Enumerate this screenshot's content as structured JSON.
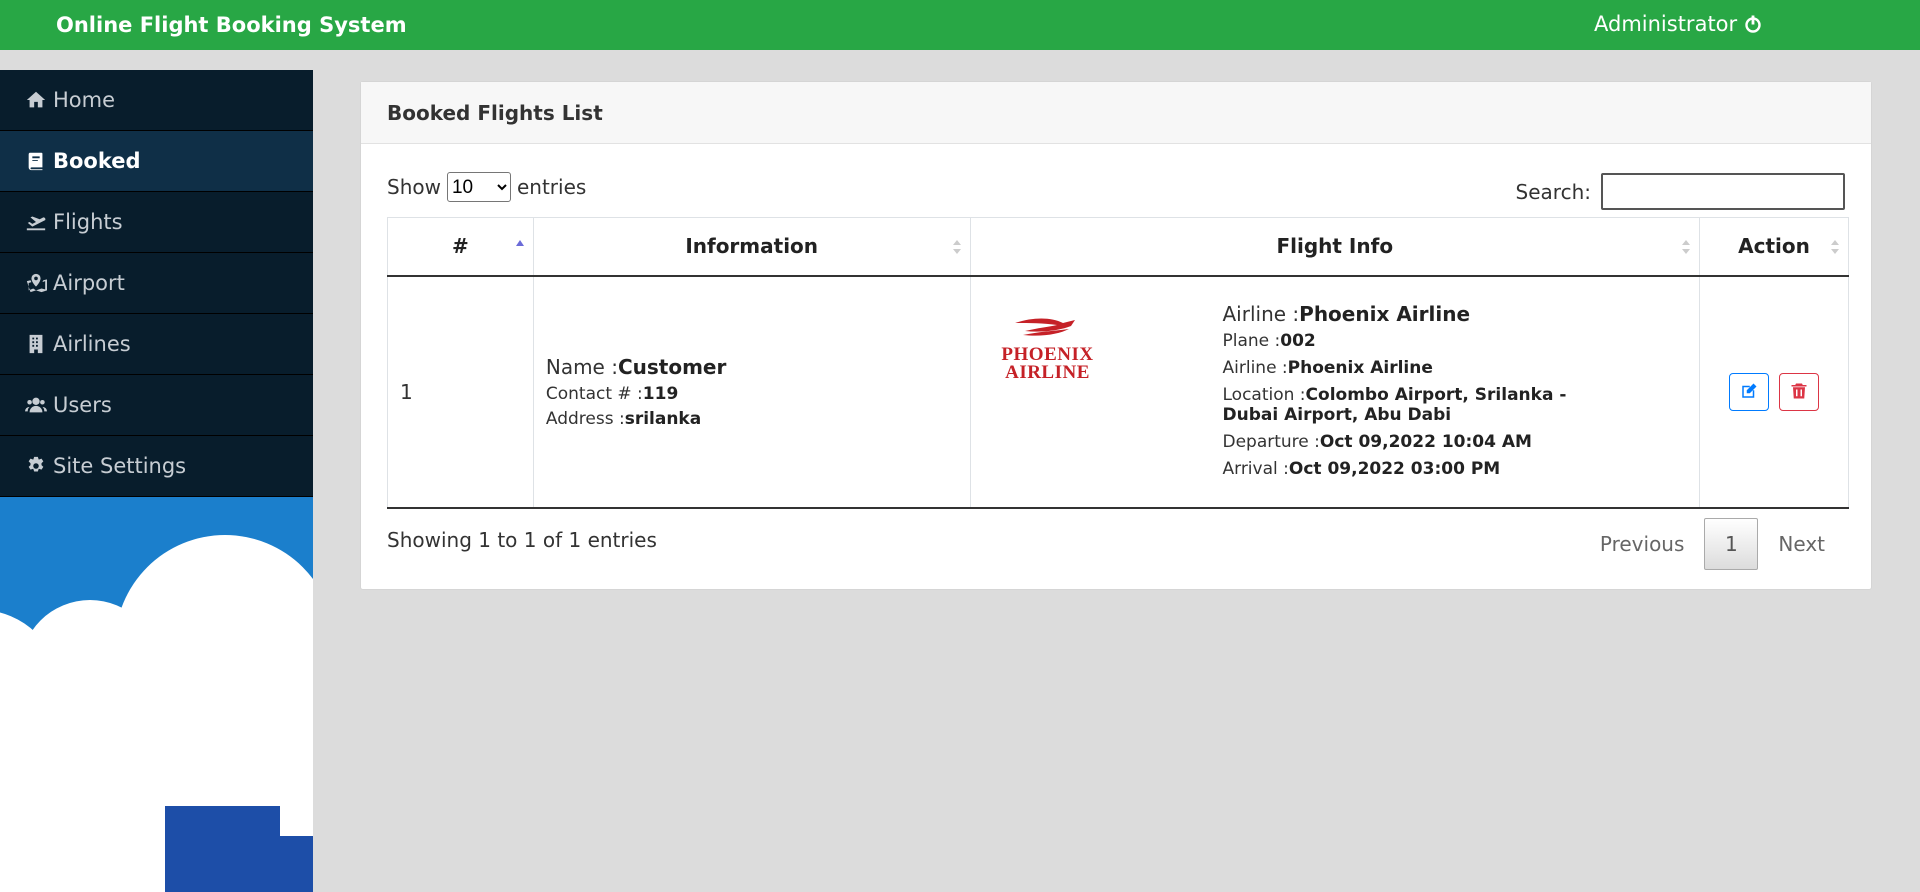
{
  "header": {
    "brand": "Online Flight Booking System",
    "user": "Administrator",
    "colors": {
      "topbar": "#28a745"
    }
  },
  "sidebar": {
    "items": [
      {
        "label": "Home",
        "icon": "home-icon",
        "active": false
      },
      {
        "label": "Booked",
        "icon": "book-icon",
        "active": true
      },
      {
        "label": "Flights",
        "icon": "plane-departure-icon",
        "active": false
      },
      {
        "label": "Airport",
        "icon": "map-marked-icon",
        "active": false
      },
      {
        "label": "Airlines",
        "icon": "building-icon",
        "active": false
      },
      {
        "label": "Users",
        "icon": "users-icon",
        "active": false
      },
      {
        "label": "Site Settings",
        "icon": "cog-icon",
        "active": false
      }
    ]
  },
  "main": {
    "title": "Booked Flights List",
    "show_label": "Show",
    "entries_label": "entries",
    "page_size": "10",
    "search_label": "Search:",
    "search_value": "",
    "columns": [
      "#",
      "Information",
      "Flight Info",
      "Action"
    ],
    "rows": [
      {
        "num": "1",
        "name_label": "Name :",
        "name": "Customer",
        "contact_label": "Contact # :",
        "contact": "119",
        "address_label": "Address :",
        "address": "srilanka",
        "logo_line1": "PHOENIX",
        "logo_line2": "AIRLINE",
        "airline_label": "Airline :",
        "airline": "Phoenix Airline",
        "plane_label": "Plane :",
        "plane": "002",
        "airline2_label": "Airline :",
        "airline2": "Phoenix Airline",
        "location_label": "Location :",
        "location_1": "Colombo Airport, Srilanka -",
        "location_2": "Dubai Airport, Abu Dabi",
        "departure_label": "Departure :",
        "departure": "Oct 09,2022 10:04 AM",
        "arrival_label": "Arrival :",
        "arrival": "Oct 09,2022 03:00 PM"
      }
    ],
    "summary": "Showing 1 to 1 of 1 entries",
    "prev": "Previous",
    "page": "1",
    "next": "Next"
  }
}
